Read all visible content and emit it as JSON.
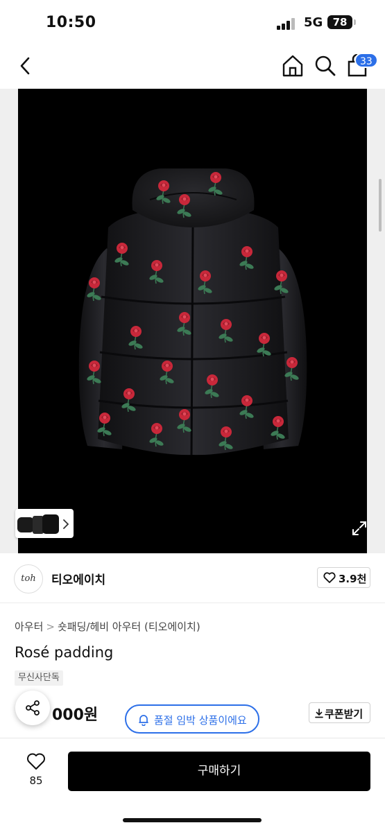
{
  "status_bar": {
    "time": "10:50",
    "network": "5G",
    "battery": "78"
  },
  "nav": {
    "back_icon": "chevron-left-icon",
    "home_icon": "home-icon",
    "search_icon": "search-icon",
    "cart_icon": "shopping-bag-icon",
    "cart_count": "33"
  },
  "gallery": {
    "thumbnail_icon": "chevron-right-icon",
    "expand_icon": "expand-icon"
  },
  "brand": {
    "logo_text": "toh",
    "name": "티오에이치",
    "like_count": "3.9천"
  },
  "product": {
    "breadcrumb": [
      "아우터",
      "숏패딩/헤비 아우터 (티오에이치)"
    ],
    "title": "Rosé padding",
    "tag": "무신사단독",
    "price": "000원"
  },
  "actions": {
    "soldout_notice": "품절 임박 상품이에요",
    "coupon_label": "쿠폰받기",
    "wish_count": "85",
    "buy_label": "구매하기"
  },
  "colors": {
    "accent": "#2c6fe8",
    "buy_button": "#000000",
    "rose": "#c8283a",
    "leaf": "#3c7a55"
  }
}
